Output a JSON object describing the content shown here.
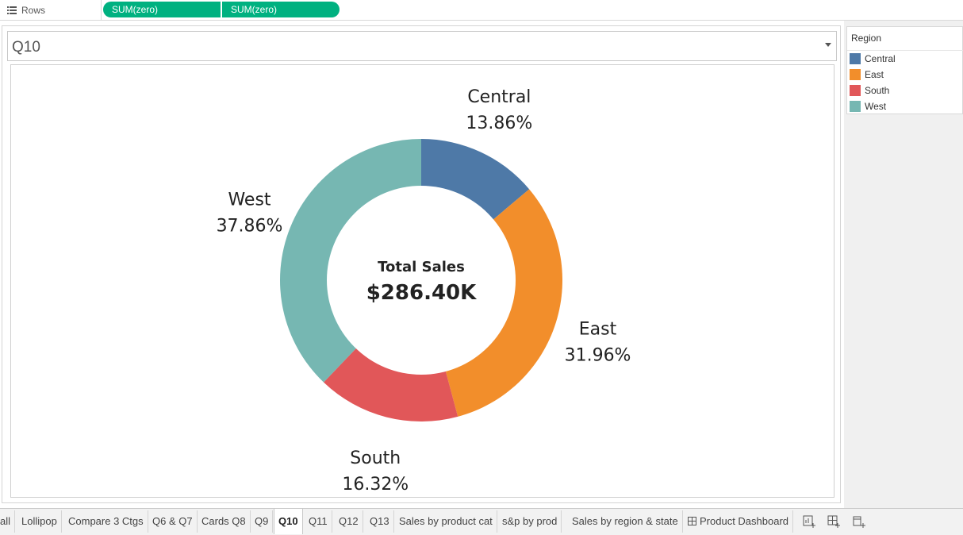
{
  "shelf": {
    "label": "Rows",
    "pills": [
      "SUM(zero)",
      "SUM(zero)"
    ]
  },
  "worksheet": {
    "title": "Q10"
  },
  "chart_data": {
    "type": "pie",
    "center_label": "Total Sales",
    "center_value": "$286.40K",
    "slices": [
      {
        "name": "Central",
        "percent": 13.86,
        "label": "13.86%",
        "color": "#4e79a7"
      },
      {
        "name": "East",
        "percent": 31.96,
        "label": "31.96%",
        "color": "#f28e2b"
      },
      {
        "name": "South",
        "percent": 16.32,
        "label": "16.32%",
        "color": "#e15759"
      },
      {
        "name": "West",
        "percent": 37.86,
        "label": "37.86%",
        "color": "#76b7b2"
      }
    ]
  },
  "legend": {
    "title": "Region",
    "items": [
      {
        "label": "Central",
        "color": "#4e79a7"
      },
      {
        "label": "East",
        "color": "#f28e2b"
      },
      {
        "label": "South",
        "color": "#e15759"
      },
      {
        "label": "West",
        "color": "#76b7b2"
      }
    ]
  },
  "tabs": {
    "items": [
      "all",
      "Lollipop",
      "Compare 3 Ctgs",
      "Q6 & Q7",
      "Cards Q8",
      "Q9",
      "Q10",
      "Q11",
      "Q12",
      "Q13",
      "Sales by product cat",
      "s&p by prod",
      "Sales by region & state",
      "Product Dashboard"
    ],
    "active": "Q10"
  },
  "colors": {
    "pill": "#00b180",
    "accent_central": "#4e79a7",
    "accent_east": "#f28e2b",
    "accent_south": "#e15759",
    "accent_west": "#76b7b2"
  },
  "icons": [
    "rows-shelf-icon",
    "dropdown-caret-icon",
    "dashboard-icon",
    "new-worksheet-icon",
    "new-dashboard-icon",
    "new-story-icon"
  ]
}
